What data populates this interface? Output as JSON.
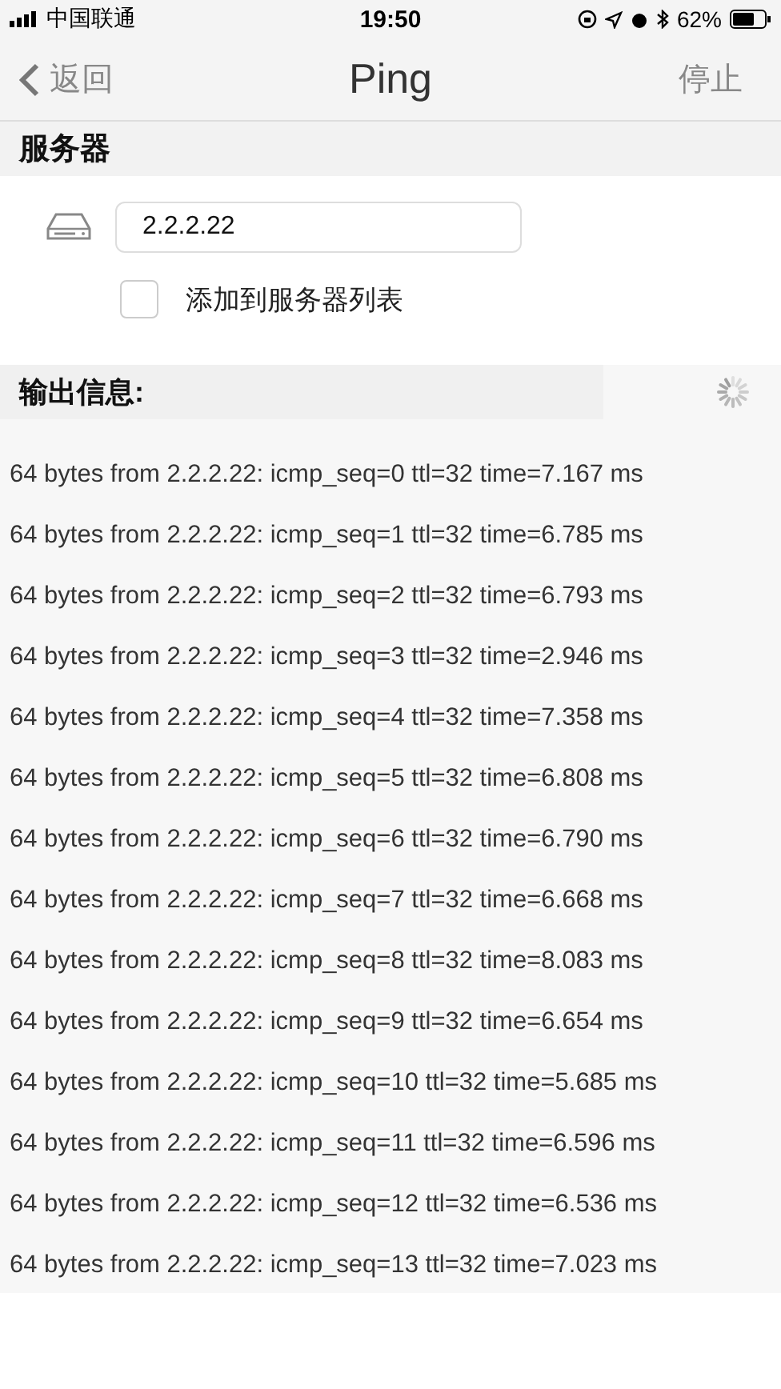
{
  "status_bar": {
    "carrier": "中国联通",
    "time": "19:50",
    "battery": "62%"
  },
  "nav": {
    "back": "返回",
    "title": "Ping",
    "action": "停止"
  },
  "server_section": {
    "title": "服务器",
    "address": "2.2.2.22",
    "add_to_list": {
      "label": "添加到服务器列表",
      "checked": false
    }
  },
  "output": {
    "title": "输出信息:",
    "running": true,
    "lines": [
      "64 bytes from 2.2.2.22: icmp_seq=0 ttl=32 time=7.167 ms",
      "64 bytes from 2.2.2.22: icmp_seq=1 ttl=32 time=6.785 ms",
      "64 bytes from 2.2.2.22: icmp_seq=2 ttl=32 time=6.793 ms",
      "64 bytes from 2.2.2.22: icmp_seq=3 ttl=32 time=2.946 ms",
      "64 bytes from 2.2.2.22: icmp_seq=4 ttl=32 time=7.358 ms",
      "64 bytes from 2.2.2.22: icmp_seq=5 ttl=32 time=6.808 ms",
      "64 bytes from 2.2.2.22: icmp_seq=6 ttl=32 time=6.790 ms",
      "64 bytes from 2.2.2.22: icmp_seq=7 ttl=32 time=6.668 ms",
      "64 bytes from 2.2.2.22: icmp_seq=8 ttl=32 time=8.083 ms",
      "64 bytes from 2.2.2.22: icmp_seq=9 ttl=32 time=6.654 ms",
      "64 bytes from 2.2.2.22: icmp_seq=10 ttl=32 time=5.685 ms",
      "64 bytes from 2.2.2.22: icmp_seq=11 ttl=32 time=6.596 ms",
      "64 bytes from 2.2.2.22: icmp_seq=12 ttl=32 time=6.536 ms",
      "64 bytes from 2.2.2.22: icmp_seq=13 ttl=32 time=7.023 ms"
    ]
  }
}
